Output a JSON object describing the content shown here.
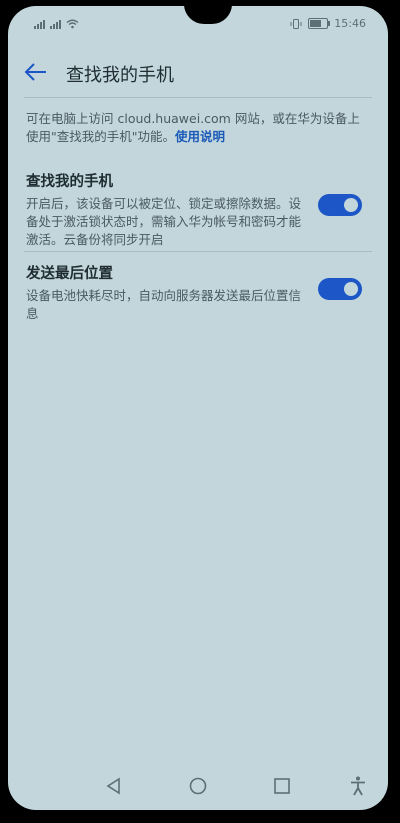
{
  "status_bar": {
    "left_icons": [
      "signal-icon",
      "signal-icon",
      "wifi-icon"
    ],
    "right_icons": [
      "vibrate-icon",
      "battery-icon"
    ],
    "time": "15:46"
  },
  "header": {
    "title": "查找我的手机",
    "back_icon": "back-arrow-icon"
  },
  "intro": {
    "text": "可在电脑上访问 cloud.huawei.com 网站，或在华为设备上使用\"查找我的手机\"功能。",
    "link": "使用说明"
  },
  "settings": [
    {
      "title": "查找我的手机",
      "description": "开启后，该设备可以被定位、锁定或擦除数据。设备处于激活锁状态时，需输入华为帐号和密码才能激活。云备份将同步开启",
      "enabled": true
    },
    {
      "title": "发送最后位置",
      "description": "设备电池快耗尽时，自动向服务器发送最后位置信息",
      "enabled": true
    }
  ],
  "nav_bar": {
    "buttons": [
      "back-triangle-icon",
      "home-circle-icon",
      "recents-square-icon",
      "accessibility-icon"
    ]
  },
  "colors": {
    "background": "#c3d6dc",
    "accent": "#1d56c7",
    "link": "#1b5bb8"
  }
}
